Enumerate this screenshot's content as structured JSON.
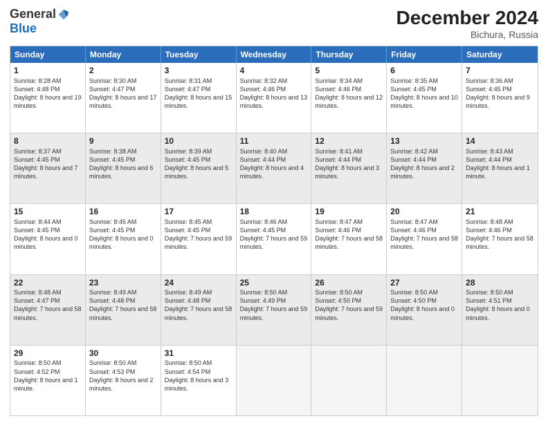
{
  "header": {
    "logo": {
      "general": "General",
      "blue": "Blue"
    },
    "title": "December 2024",
    "location": "Bichura, Russia"
  },
  "days_of_week": [
    "Sunday",
    "Monday",
    "Tuesday",
    "Wednesday",
    "Thursday",
    "Friday",
    "Saturday"
  ],
  "weeks": [
    [
      {
        "day": "1",
        "sr": "8:28 AM",
        "ss": "4:48 PM",
        "dl": "8 hours and 19 minutes.",
        "shaded": false
      },
      {
        "day": "2",
        "sr": "8:30 AM",
        "ss": "4:47 PM",
        "dl": "8 hours and 17 minutes.",
        "shaded": false
      },
      {
        "day": "3",
        "sr": "8:31 AM",
        "ss": "4:47 PM",
        "dl": "8 hours and 15 minutes.",
        "shaded": false
      },
      {
        "day": "4",
        "sr": "8:32 AM",
        "ss": "4:46 PM",
        "dl": "8 hours and 13 minutes.",
        "shaded": false
      },
      {
        "day": "5",
        "sr": "8:34 AM",
        "ss": "4:46 PM",
        "dl": "8 hours and 12 minutes.",
        "shaded": false
      },
      {
        "day": "6",
        "sr": "8:35 AM",
        "ss": "4:45 PM",
        "dl": "8 hours and 10 minutes.",
        "shaded": false
      },
      {
        "day": "7",
        "sr": "8:36 AM",
        "ss": "4:45 PM",
        "dl": "8 hours and 9 minutes.",
        "shaded": false
      }
    ],
    [
      {
        "day": "8",
        "sr": "8:37 AM",
        "ss": "4:45 PM",
        "dl": "8 hours and 7 minutes.",
        "shaded": true
      },
      {
        "day": "9",
        "sr": "8:38 AM",
        "ss": "4:45 PM",
        "dl": "8 hours and 6 minutes.",
        "shaded": true
      },
      {
        "day": "10",
        "sr": "8:39 AM",
        "ss": "4:45 PM",
        "dl": "8 hours and 5 minutes.",
        "shaded": true
      },
      {
        "day": "11",
        "sr": "8:40 AM",
        "ss": "4:44 PM",
        "dl": "8 hours and 4 minutes.",
        "shaded": true
      },
      {
        "day": "12",
        "sr": "8:41 AM",
        "ss": "4:44 PM",
        "dl": "8 hours and 3 minutes.",
        "shaded": true
      },
      {
        "day": "13",
        "sr": "8:42 AM",
        "ss": "4:44 PM",
        "dl": "8 hours and 2 minutes.",
        "shaded": true
      },
      {
        "day": "14",
        "sr": "8:43 AM",
        "ss": "4:44 PM",
        "dl": "8 hours and 1 minute.",
        "shaded": true
      }
    ],
    [
      {
        "day": "15",
        "sr": "8:44 AM",
        "ss": "4:45 PM",
        "dl": "8 hours and 0 minutes.",
        "shaded": false
      },
      {
        "day": "16",
        "sr": "8:45 AM",
        "ss": "4:45 PM",
        "dl": "8 hours and 0 minutes.",
        "shaded": false
      },
      {
        "day": "17",
        "sr": "8:45 AM",
        "ss": "4:45 PM",
        "dl": "7 hours and 59 minutes.",
        "shaded": false
      },
      {
        "day": "18",
        "sr": "8:46 AM",
        "ss": "4:45 PM",
        "dl": "7 hours and 59 minutes.",
        "shaded": false
      },
      {
        "day": "19",
        "sr": "8:47 AM",
        "ss": "4:46 PM",
        "dl": "7 hours and 58 minutes.",
        "shaded": false
      },
      {
        "day": "20",
        "sr": "8:47 AM",
        "ss": "4:46 PM",
        "dl": "7 hours and 58 minutes.",
        "shaded": false
      },
      {
        "day": "21",
        "sr": "8:48 AM",
        "ss": "4:46 PM",
        "dl": "7 hours and 58 minutes.",
        "shaded": false
      }
    ],
    [
      {
        "day": "22",
        "sr": "8:48 AM",
        "ss": "4:47 PM",
        "dl": "7 hours and 58 minutes.",
        "shaded": true
      },
      {
        "day": "23",
        "sr": "8:49 AM",
        "ss": "4:48 PM",
        "dl": "7 hours and 58 minutes.",
        "shaded": true
      },
      {
        "day": "24",
        "sr": "8:49 AM",
        "ss": "4:48 PM",
        "dl": "7 hours and 58 minutes.",
        "shaded": true
      },
      {
        "day": "25",
        "sr": "8:50 AM",
        "ss": "4:49 PM",
        "dl": "7 hours and 59 minutes.",
        "shaded": true
      },
      {
        "day": "26",
        "sr": "8:50 AM",
        "ss": "4:50 PM",
        "dl": "7 hours and 59 minutes.",
        "shaded": true
      },
      {
        "day": "27",
        "sr": "8:50 AM",
        "ss": "4:50 PM",
        "dl": "8 hours and 0 minutes.",
        "shaded": true
      },
      {
        "day": "28",
        "sr": "8:50 AM",
        "ss": "4:51 PM",
        "dl": "8 hours and 0 minutes.",
        "shaded": true
      }
    ],
    [
      {
        "day": "29",
        "sr": "8:50 AM",
        "ss": "4:52 PM",
        "dl": "8 hours and 1 minute.",
        "shaded": false
      },
      {
        "day": "30",
        "sr": "8:50 AM",
        "ss": "4:53 PM",
        "dl": "8 hours and 2 minutes.",
        "shaded": false
      },
      {
        "day": "31",
        "sr": "8:50 AM",
        "ss": "4:54 PM",
        "dl": "8 hours and 3 minutes.",
        "shaded": false
      },
      {
        "day": "",
        "sr": "",
        "ss": "",
        "dl": "",
        "shaded": false,
        "empty": true
      },
      {
        "day": "",
        "sr": "",
        "ss": "",
        "dl": "",
        "shaded": false,
        "empty": true
      },
      {
        "day": "",
        "sr": "",
        "ss": "",
        "dl": "",
        "shaded": false,
        "empty": true
      },
      {
        "day": "",
        "sr": "",
        "ss": "",
        "dl": "",
        "shaded": false,
        "empty": true
      }
    ]
  ]
}
